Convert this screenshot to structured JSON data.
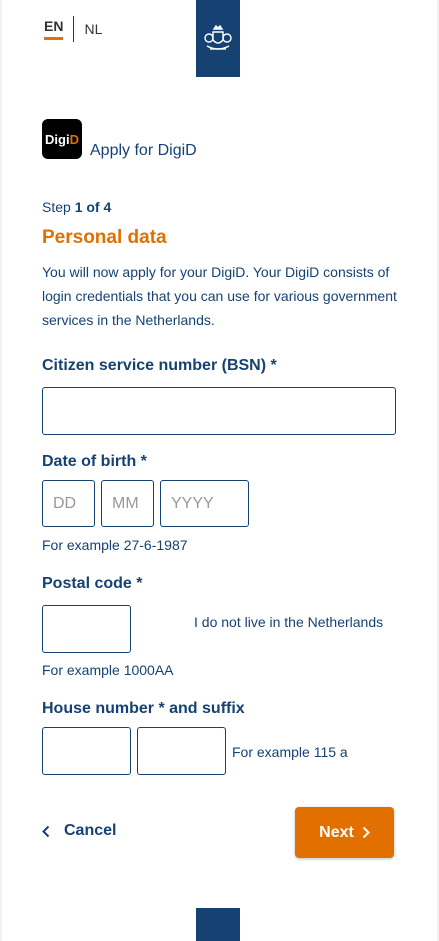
{
  "language": {
    "active": "EN",
    "other": "NL"
  },
  "header": {
    "app_title": "Apply for DigiD",
    "logo_text_main": "Digi",
    "logo_text_accent": "D"
  },
  "step": {
    "prefix": "Step",
    "current": "1 of 4"
  },
  "section": {
    "title": "Personal data",
    "intro": "You will now apply for your DigiD. Your DigiD consists of login credentials that you can use for various government services in the Netherlands."
  },
  "form": {
    "bsn": {
      "label": "Citizen service number (BSN)  *",
      "value": ""
    },
    "dob": {
      "label": "Date of birth  *",
      "day_placeholder": "DD",
      "month_placeholder": "MM",
      "year_placeholder": "YYYY",
      "hint": "For example 27-6-1987"
    },
    "postal": {
      "label": "Postal code  *",
      "hint": "For example 1000AA",
      "not_nl_link": "I do not live in the Netherlands"
    },
    "house": {
      "label": "House number   * and suffix",
      "hint": "For example 115 a"
    }
  },
  "actions": {
    "cancel_label": "Cancel",
    "next_label": "Next"
  },
  "colors": {
    "brand_blue": "#154273",
    "accent_orange": "#e17000"
  }
}
